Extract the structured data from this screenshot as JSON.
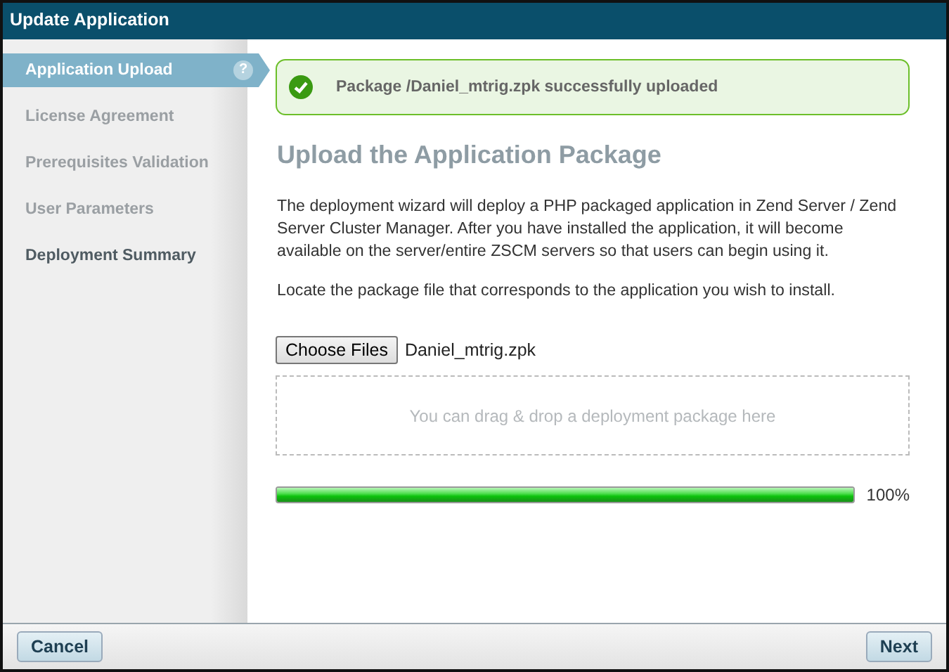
{
  "window": {
    "title": "Update Application"
  },
  "steps": [
    {
      "label": "Application Upload",
      "selected": true,
      "disabled": false,
      "help": "?"
    },
    {
      "label": "License Agreement",
      "selected": false,
      "disabled": true
    },
    {
      "label": "Prerequisites Validation",
      "selected": false,
      "disabled": true
    },
    {
      "label": "User Parameters",
      "selected": false,
      "disabled": true
    },
    {
      "label": "Deployment Summary",
      "selected": false,
      "disabled": false
    }
  ],
  "notice": {
    "text": "Package /Daniel_mtrig.zpk successfully uploaded"
  },
  "heading": "Upload the Application Package",
  "paragraphs": [
    "The deployment wizard will deploy a PHP packaged application in Zend Server / Zend Server Cluster Manager. After you have installed the application, it will become available on the server/entire ZSCM servers so that users can begin using it.",
    "Locate the package file that corresponds to the application you wish to install."
  ],
  "file_input": {
    "button": "Choose Files",
    "value": "Daniel_mtrig.zpk"
  },
  "drop_zone": {
    "placeholder": "You can drag & drop a deployment package here"
  },
  "progress": {
    "level": 1,
    "reading": "100%"
  },
  "buttons": [
    "Cancel",
    "Next"
  ]
}
